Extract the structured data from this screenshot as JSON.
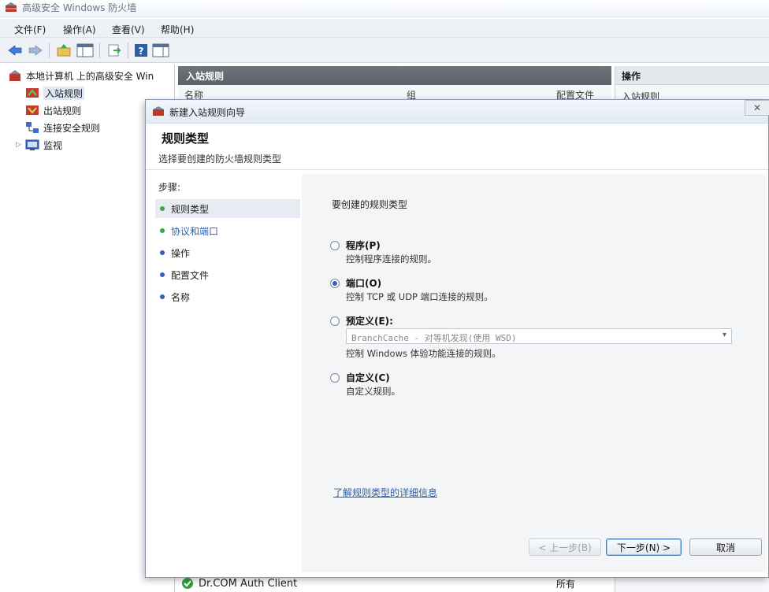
{
  "window": {
    "title": "高级安全 Windows 防火墙"
  },
  "menu": [
    {
      "label": "文件(F)"
    },
    {
      "label": "操作(A)"
    },
    {
      "label": "查看(V)"
    },
    {
      "label": "帮助(H)"
    }
  ],
  "tree": {
    "root": "本地计算机 上的高级安全 Win",
    "items": [
      {
        "label": "入站规则",
        "selected": true
      },
      {
        "label": "出站规则"
      },
      {
        "label": "连接安全规则"
      },
      {
        "label": "监视"
      }
    ]
  },
  "center": {
    "header": "入站规则",
    "columns": [
      "名称",
      "组",
      "配置文件"
    ],
    "bottom_row": {
      "name": "Dr.COM Auth Client",
      "enabled": "所有"
    }
  },
  "actions_pane": {
    "header": "操作",
    "sub": "入站规则"
  },
  "dialog": {
    "title": "新建入站规则向导",
    "close_label": "✕",
    "header_title": "规则类型",
    "header_subtitle": "选择要创建的防火墙规则类型",
    "steps_title": "步骤:",
    "steps": [
      {
        "label": "规则类型",
        "active": true
      },
      {
        "label": "协议和端口",
        "link": true
      },
      {
        "label": "操作"
      },
      {
        "label": "配置文件"
      },
      {
        "label": "名称"
      }
    ],
    "prompt": "要创建的规则类型",
    "options": [
      {
        "label": "程序(P)",
        "desc": "控制程序连接的规则。",
        "checked": false
      },
      {
        "label": "端口(O)",
        "desc": "控制 TCP 或 UDP 端口连接的规则。",
        "checked": true
      },
      {
        "label": "预定义(E):",
        "desc": "控制 Windows 体验功能连接的规则。",
        "checked": false
      },
      {
        "label": "自定义(C)",
        "desc": "自定义规则。",
        "checked": false
      }
    ],
    "predefined_value": "BranchCache - 对等机发现(使用 WSD)",
    "learn_more": "了解规则类型的详细信息",
    "buttons": {
      "back": "< 上一步(B)",
      "next": "下一步(N) >",
      "cancel": "取消"
    }
  },
  "colors": {
    "accent": "#2f62b8",
    "green_dot": "#3aa64a",
    "blue_dot": "#3a5fb8",
    "header_gray": "#5b6169"
  }
}
